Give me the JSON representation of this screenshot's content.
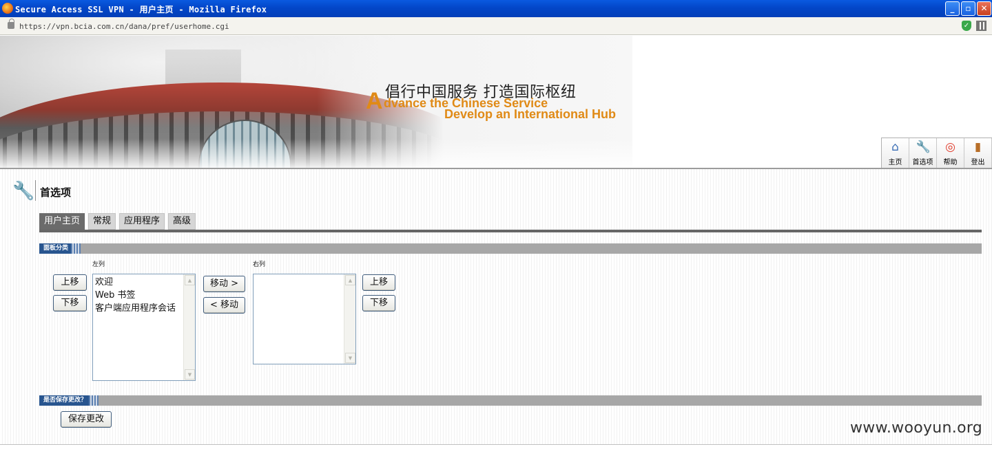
{
  "window": {
    "title": "Secure Access SSL VPN - 用户主页 - Mozilla Firefox",
    "minimize_glyph": "_",
    "restore_glyph": "▫",
    "close_glyph": "✕"
  },
  "browser": {
    "url": "https://vpn.bcia.com.cn/dana/pref/userhome.cgi"
  },
  "banner": {
    "slogan_cn": "倡行中国服务 打造国际枢纽",
    "slogan_initial": "A",
    "slogan_en_line1": "dvance the Chinese Service",
    "slogan_en_line2": "Develop an International Hub",
    "accent_color": "#e08a16"
  },
  "toolbar": {
    "items": [
      {
        "label": "主页",
        "icon": "home-icon"
      },
      {
        "label": "首选项",
        "icon": "wrench-icon"
      },
      {
        "label": "帮助",
        "icon": "lifebuoy-icon"
      },
      {
        "label": "登出",
        "icon": "door-icon"
      }
    ]
  },
  "page": {
    "title": "首选项"
  },
  "tabs": [
    {
      "label": "用户主页",
      "active": true
    },
    {
      "label": "常规",
      "active": false
    },
    {
      "label": "应用程序",
      "active": false
    },
    {
      "label": "高级",
      "active": false
    }
  ],
  "panel": {
    "section_label": "面板分类",
    "left_column_label": "左列",
    "right_column_label": "右列",
    "left_items": [
      "欢迎",
      "Web 书签",
      "客户端应用程序会话"
    ],
    "right_items": [],
    "move_up": "上移",
    "move_down": "下移",
    "move_right": "移动 >",
    "move_left": "< 移动"
  },
  "save": {
    "section_label": "是否保存更改？",
    "button_label": "保存更改"
  },
  "watermark": "www.wooyun.org"
}
